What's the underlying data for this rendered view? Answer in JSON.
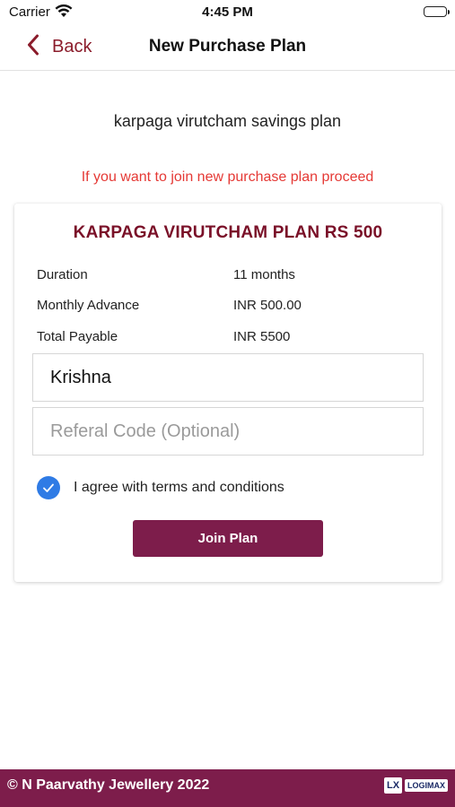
{
  "status_bar": {
    "carrier": "Carrier",
    "time": "4:45 PM"
  },
  "nav": {
    "back_label": "Back",
    "title": "New Purchase Plan"
  },
  "plan_name": "karpaga virutcham savings plan",
  "notice": "If you want to join new purchase plan proceed",
  "card": {
    "title": "KARPAGA VIRUTCHAM PLAN RS 500",
    "details": [
      {
        "label": "Duration",
        "value": "11 months"
      },
      {
        "label": "Monthly Advance",
        "value": "INR 500.00"
      },
      {
        "label": "Total Payable",
        "value": "INR 5500"
      }
    ],
    "name_field": {
      "value": "Krishna",
      "placeholder": ""
    },
    "referral_field": {
      "value": "",
      "placeholder": "Referal Code (Optional)"
    },
    "agree_label": "I agree with terms and conditions",
    "agree_checked": true,
    "join_label": "Join Plan"
  },
  "footer": {
    "copyright": "© N Paarvathy Jewellery 2022",
    "logo_mark": "LX",
    "logo_text": "LOGIMAX"
  },
  "colors": {
    "brand": "#7d1d4b",
    "notice": "#e53935",
    "check": "#2f7be5",
    "title": "#7a1028"
  }
}
